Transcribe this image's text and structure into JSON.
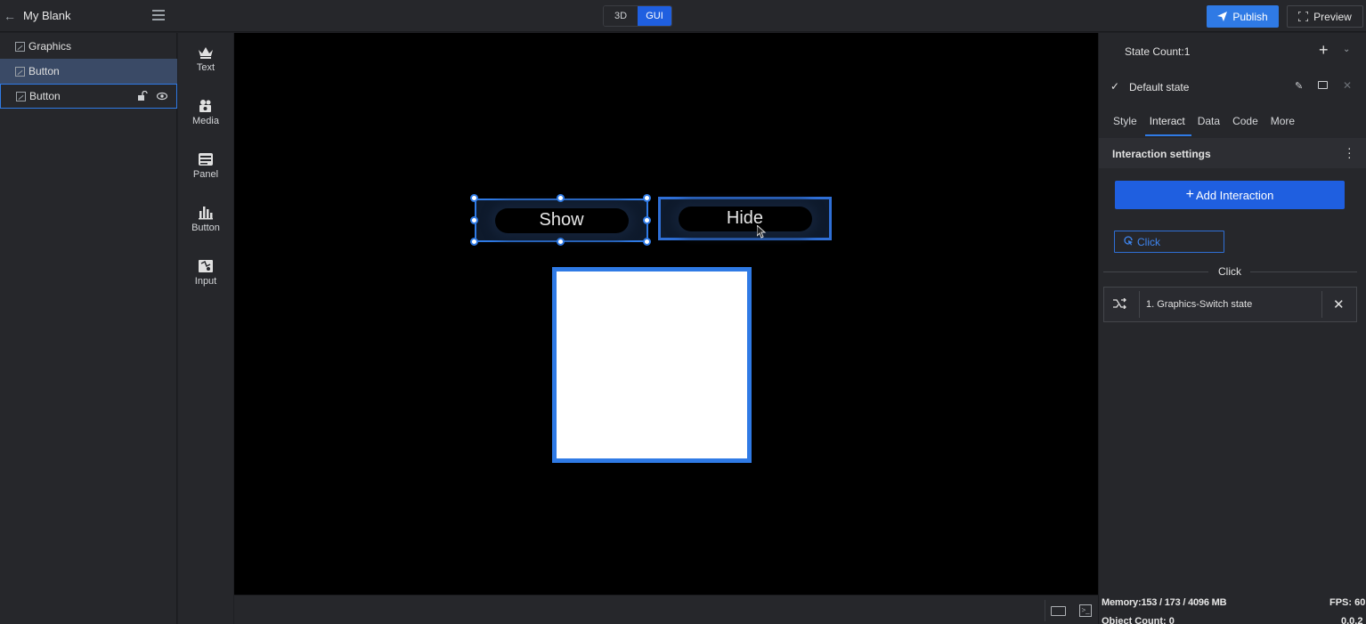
{
  "header": {
    "project_title": "My Blank",
    "modes": [
      "3D",
      "GUI"
    ],
    "active_mode": "GUI",
    "publish_label": "Publish",
    "preview_label": "Preview"
  },
  "layers": [
    {
      "label": "Graphics",
      "state": "normal"
    },
    {
      "label": "Button",
      "state": "selected"
    },
    {
      "label": "Button",
      "state": "hovered"
    }
  ],
  "widgets": [
    {
      "label": "Text",
      "icon": "crown-icon"
    },
    {
      "label": "Media",
      "icon": "camera-icon"
    },
    {
      "label": "Panel",
      "icon": "panel-icon"
    },
    {
      "label": "Button",
      "icon": "bar-chart-icon"
    },
    {
      "label": "Input",
      "icon": "map-icon"
    }
  ],
  "canvas": {
    "show_button_label": "Show",
    "hide_button_label": "Hide"
  },
  "properties": {
    "state_count": "State Count:1",
    "state_name": "Default state",
    "tabs": [
      "Style",
      "Interact",
      "Data",
      "Code",
      "More"
    ],
    "active_tab": "Interact",
    "section_title": "Interaction settings",
    "add_interaction_label": "Add Interaction",
    "event_tag": "Click",
    "divider_label": "Click",
    "action_text": "1. Graphics-Switch state"
  },
  "status": {
    "memory": "Memory:153 / 173 / 4096 MB",
    "fps": "FPS: 60",
    "object_count": "Object Count: 0",
    "version": "0.0.2"
  },
  "colors": {
    "accent": "#2f7ae5",
    "primary_button": "#1f5fe0",
    "panel_bg": "#26272b",
    "canvas_bg": "#000000"
  }
}
